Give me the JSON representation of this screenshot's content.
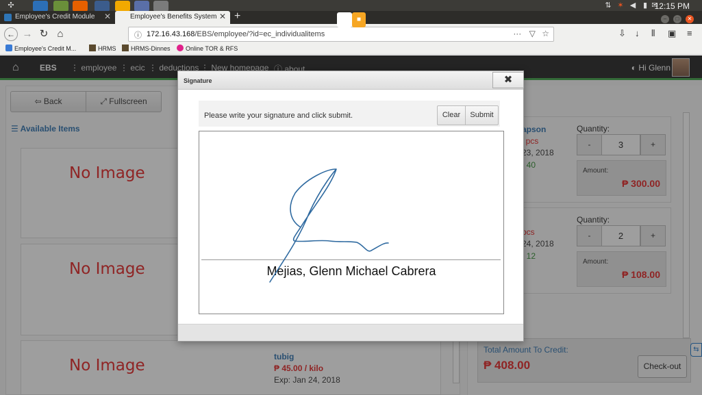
{
  "os_panel": {
    "clock": "12:15 PM"
  },
  "browser": {
    "tabs": [
      {
        "label": "Employee's Credit Module"
      },
      {
        "label": "Employee's Benefits System"
      }
    ],
    "url": {
      "host": "172.16.43.168",
      "path": "/EBS/employee/?id=ec_individualitems"
    },
    "bookmarks": [
      {
        "label": "Employee's Credit M..."
      },
      {
        "label": "HRMS"
      },
      {
        "label": "HRMS-Dinnes"
      },
      {
        "label": "Online TOR & RFS"
      }
    ]
  },
  "app_nav": {
    "brand": "EBS",
    "items": [
      "employee",
      "ecic",
      "deductions",
      "New homepage",
      "about"
    ],
    "greeting": "Hi Glenn"
  },
  "left": {
    "back_label": "Back",
    "fullscreen_label": "Fullscreen",
    "section_title": "Available Items",
    "no_image_text": "No Image",
    "item3": {
      "name": "tubig",
      "price": "₱ 45.00 / kilo",
      "exp": "Exp: Jan 24, 2018"
    }
  },
  "cart": {
    "quantity_label": "Quantity:",
    "amount_label": "Amount:",
    "minus": "-",
    "plus": "+",
    "items": [
      {
        "name_frag": "apson",
        "pcs_frag": "' pcs",
        "date_frag": "23, 2018",
        "stock_frag": ": 40",
        "quantity": "3",
        "amount": "₱ 300.00"
      },
      {
        "pcs_frag": "pcs",
        "date_frag": "24, 2018",
        "stock_frag": ": 12",
        "quantity": "2",
        "amount": "₱ 108.00"
      }
    ],
    "total_label": "Total Amount To Credit:",
    "total_value": "₱ 408.00",
    "checkout_label": "Check-out"
  },
  "signature_modal": {
    "title": "Signature",
    "close_glyph": "✖",
    "instruction": "Please write your signature and click submit.",
    "clear_label": "Clear",
    "submit_label": "Submit",
    "signer_name": "Mejias, Glenn Michael Cabrera"
  },
  "colors": {
    "nav_bg": "#222222",
    "nav_accent": "#3ca046",
    "link_blue": "#2a6fae",
    "price_red": "#e32222",
    "stock_green": "#2e8b2e",
    "signature_ink": "#2f6aa0"
  },
  "icons": {
    "home": "home-icon",
    "hamburger": "list-icon",
    "back": "arrow-left-icon",
    "fullscreen": "expand-icon",
    "info": "info-icon",
    "close": "close-icon"
  }
}
